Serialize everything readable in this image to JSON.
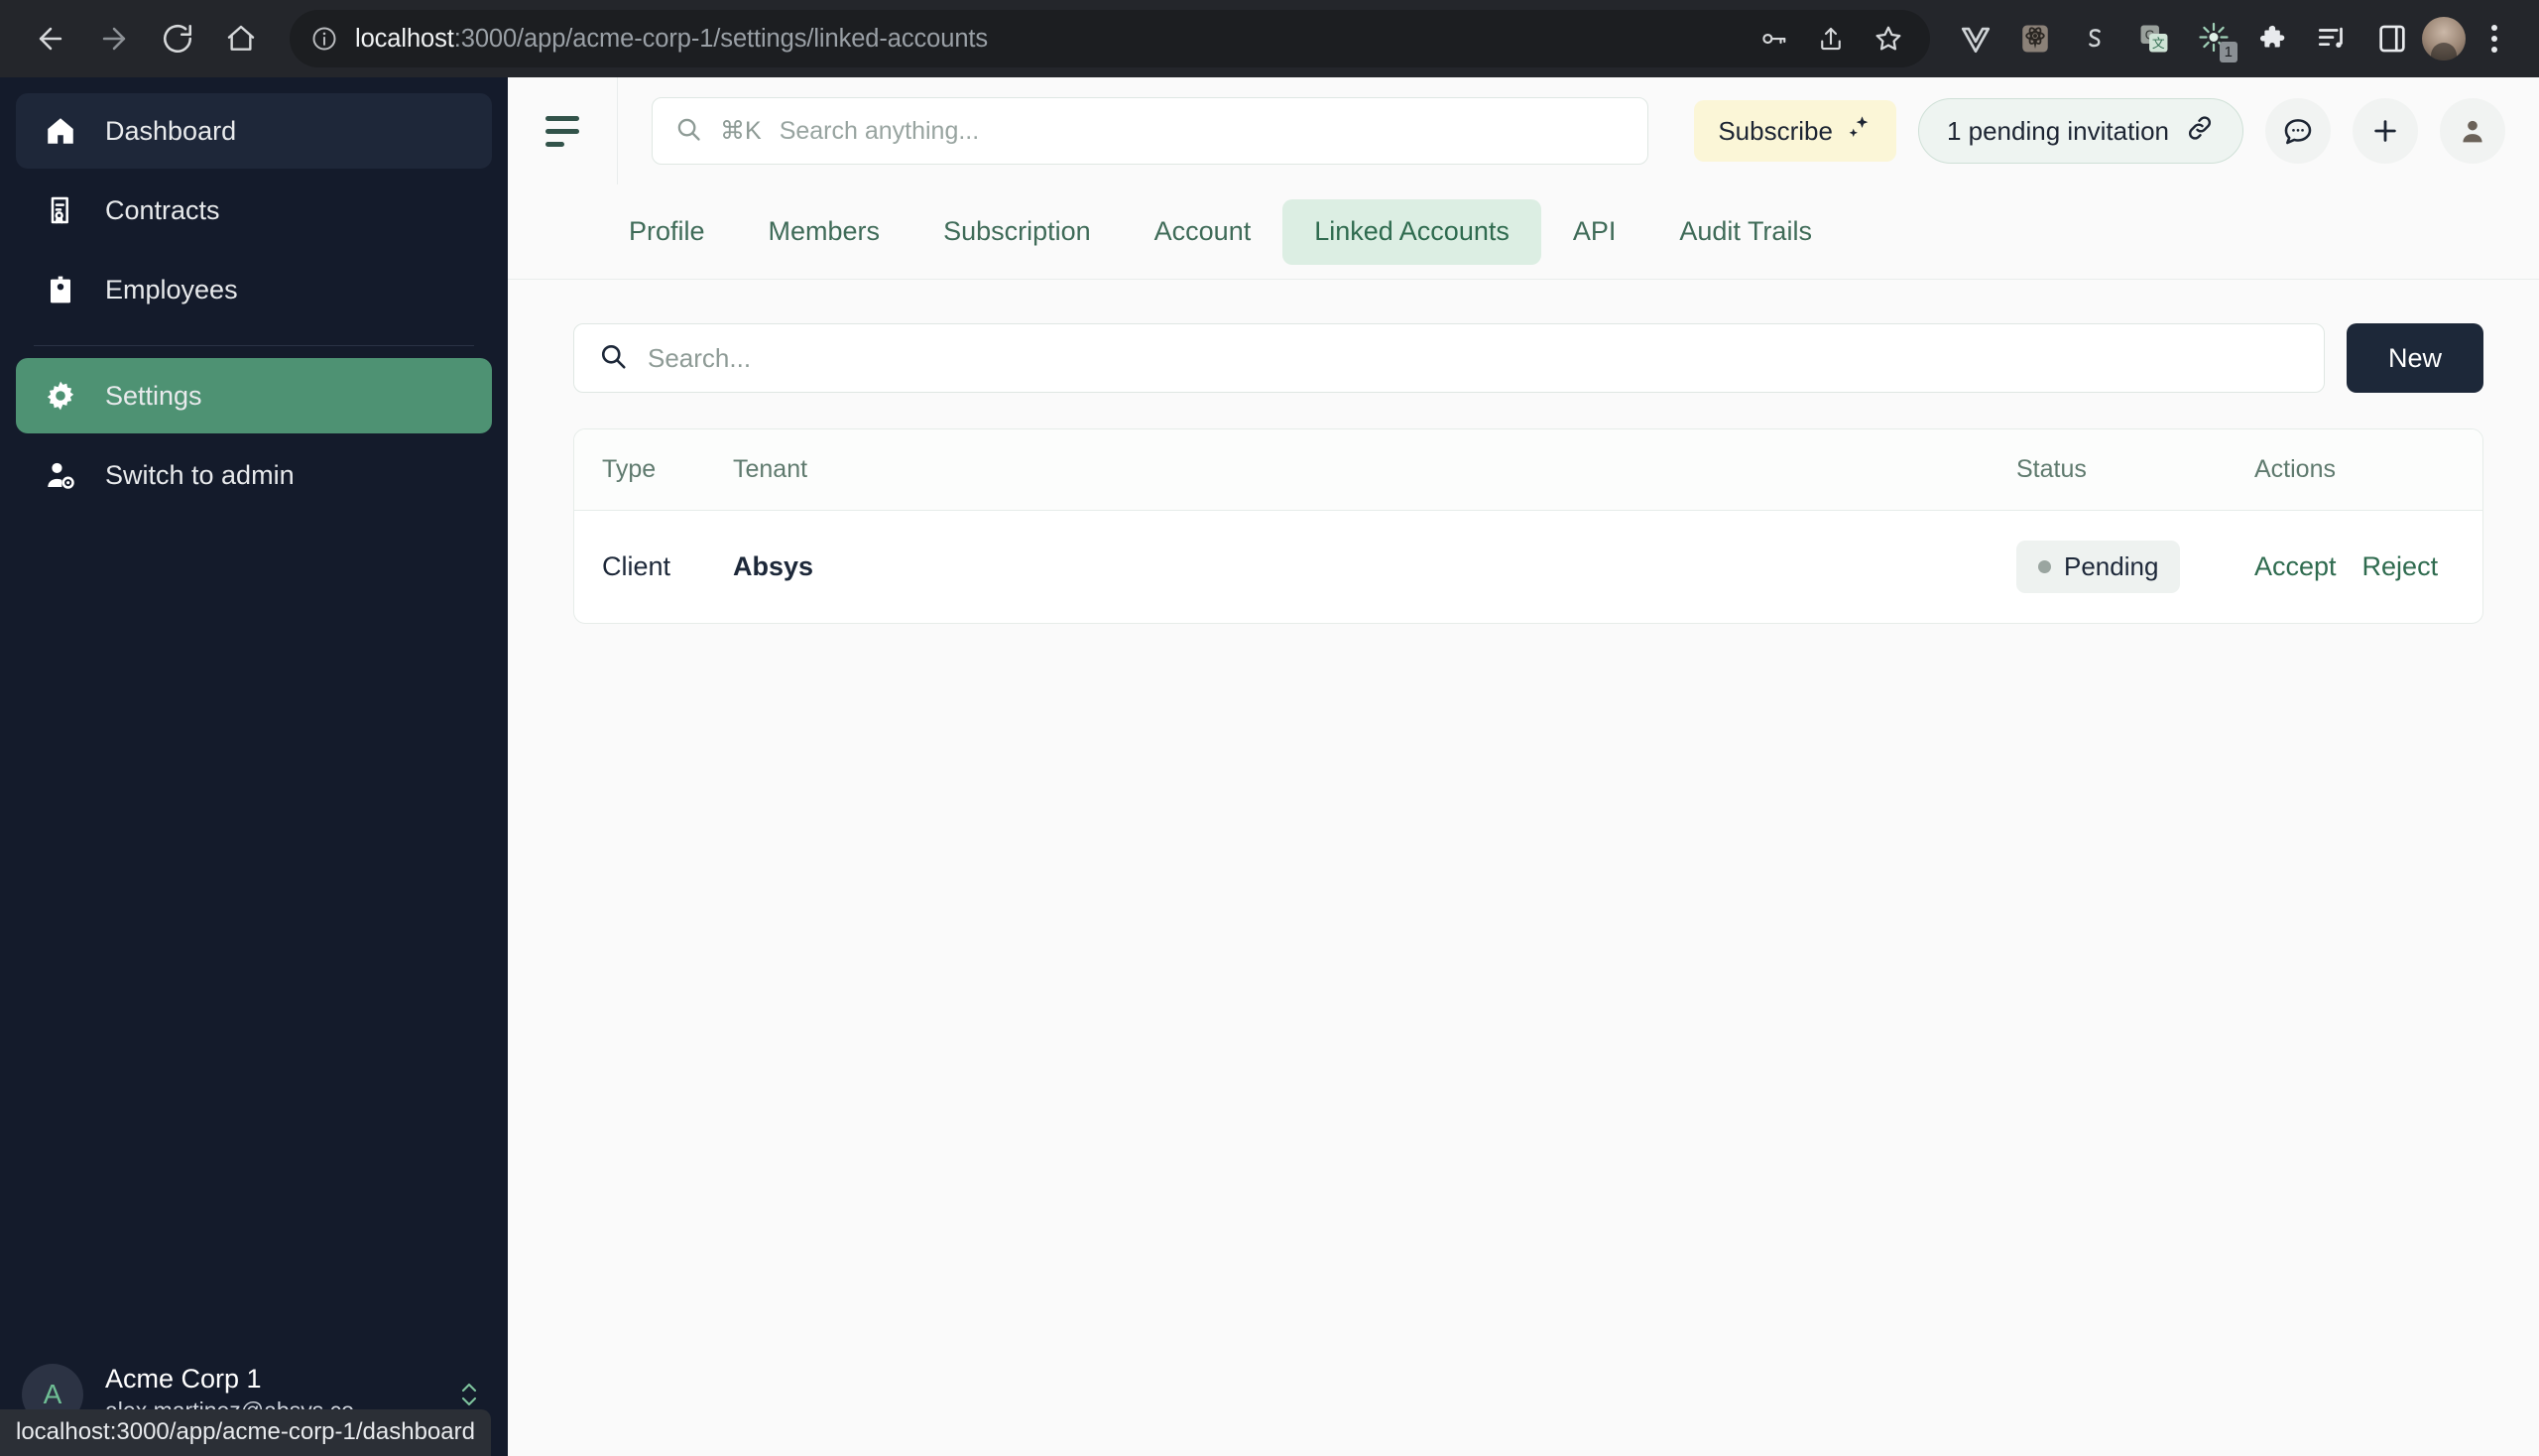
{
  "browser": {
    "url_host": "localhost",
    "url_rest": ":3000/app/acme-corp-1/settings/linked-accounts",
    "back_icon": "back-arrow-icon",
    "forward_icon": "forward-arrow-icon",
    "reload_icon": "reload-icon",
    "home_icon": "home-icon",
    "info_icon": "site-info-icon",
    "password_icon": "key-icon",
    "share_icon": "share-icon",
    "bookmark_icon": "star-icon",
    "extensions": [
      {
        "name": "vue-devtools-icon",
        "glyph": "V",
        "badge": ""
      },
      {
        "name": "react-devtools-icon",
        "glyph": "",
        "badge": ""
      },
      {
        "name": "stripe-icon",
        "glyph": "S",
        "badge": ""
      },
      {
        "name": "google-translate-icon",
        "glyph": "G",
        "badge": ""
      },
      {
        "name": "sparkle-extension-icon",
        "glyph": "",
        "badge": "1"
      },
      {
        "name": "extensions-puzzle-icon",
        "glyph": "",
        "badge": ""
      },
      {
        "name": "reading-list-icon",
        "glyph": "",
        "badge": ""
      },
      {
        "name": "side-panel-icon",
        "glyph": "",
        "badge": ""
      }
    ],
    "profile_avatar": "chrome-profile-avatar",
    "menu_icon": "three-dot-menu-icon",
    "status_text": "localhost:3000/app/acme-corp-1/dashboard"
  },
  "sidebar": {
    "items": [
      {
        "label": "Dashboard",
        "icon": "home-icon",
        "state": "hovered"
      },
      {
        "label": "Contracts",
        "icon": "contract-icon",
        "state": "normal"
      },
      {
        "label": "Employees",
        "icon": "id-badge-icon",
        "state": "normal"
      }
    ],
    "items2": [
      {
        "label": "Settings",
        "icon": "gear-icon",
        "state": "active"
      },
      {
        "label": "Switch to admin",
        "icon": "user-gear-icon",
        "state": "normal"
      }
    ],
    "footer": {
      "avatar_letter": "A",
      "org_name": "Acme Corp 1",
      "email": "alex.martinez@absys.co...",
      "switch_icon": "chevron-up-down-icon"
    }
  },
  "topbar": {
    "toggle_icon": "sidebar-toggle-icon",
    "search": {
      "icon": "search-icon",
      "kbd": "⌘K",
      "placeholder": "Search anything..."
    },
    "subscribe_label": "Subscribe",
    "subscribe_icon": "sparkles-icon",
    "invitation_label": "1 pending invitation",
    "invitation_icon": "link-icon",
    "chat_icon": "chat-bubble-icon",
    "add_icon": "plus-icon",
    "account_icon": "user-avatar-icon"
  },
  "tabs": [
    {
      "label": "Profile",
      "active": false
    },
    {
      "label": "Members",
      "active": false
    },
    {
      "label": "Subscription",
      "active": false
    },
    {
      "label": "Account",
      "active": false
    },
    {
      "label": "Linked Accounts",
      "active": true
    },
    {
      "label": "API",
      "active": false
    },
    {
      "label": "Audit Trails",
      "active": false
    }
  ],
  "content": {
    "search_placeholder": "Search...",
    "search_icon": "search-icon",
    "new_label": "New",
    "table": {
      "columns": [
        "Type",
        "Tenant",
        "Status",
        "Actions"
      ],
      "rows": [
        {
          "type": "Client",
          "tenant": "Absys",
          "status": "Pending",
          "actions": [
            "Accept",
            "Reject"
          ]
        }
      ]
    }
  },
  "colors": {
    "sidebar_bg": "#141b2b",
    "sidebar_active": "#4e9273",
    "tab_active_bg": "#dceee3",
    "tab_active_text": "#2f6b4f",
    "new_button_bg": "#1d2839",
    "subscribe_bg": "#fbf6d7",
    "link_green": "#2f6b4f",
    "status_dot": "#9aa5a0"
  }
}
